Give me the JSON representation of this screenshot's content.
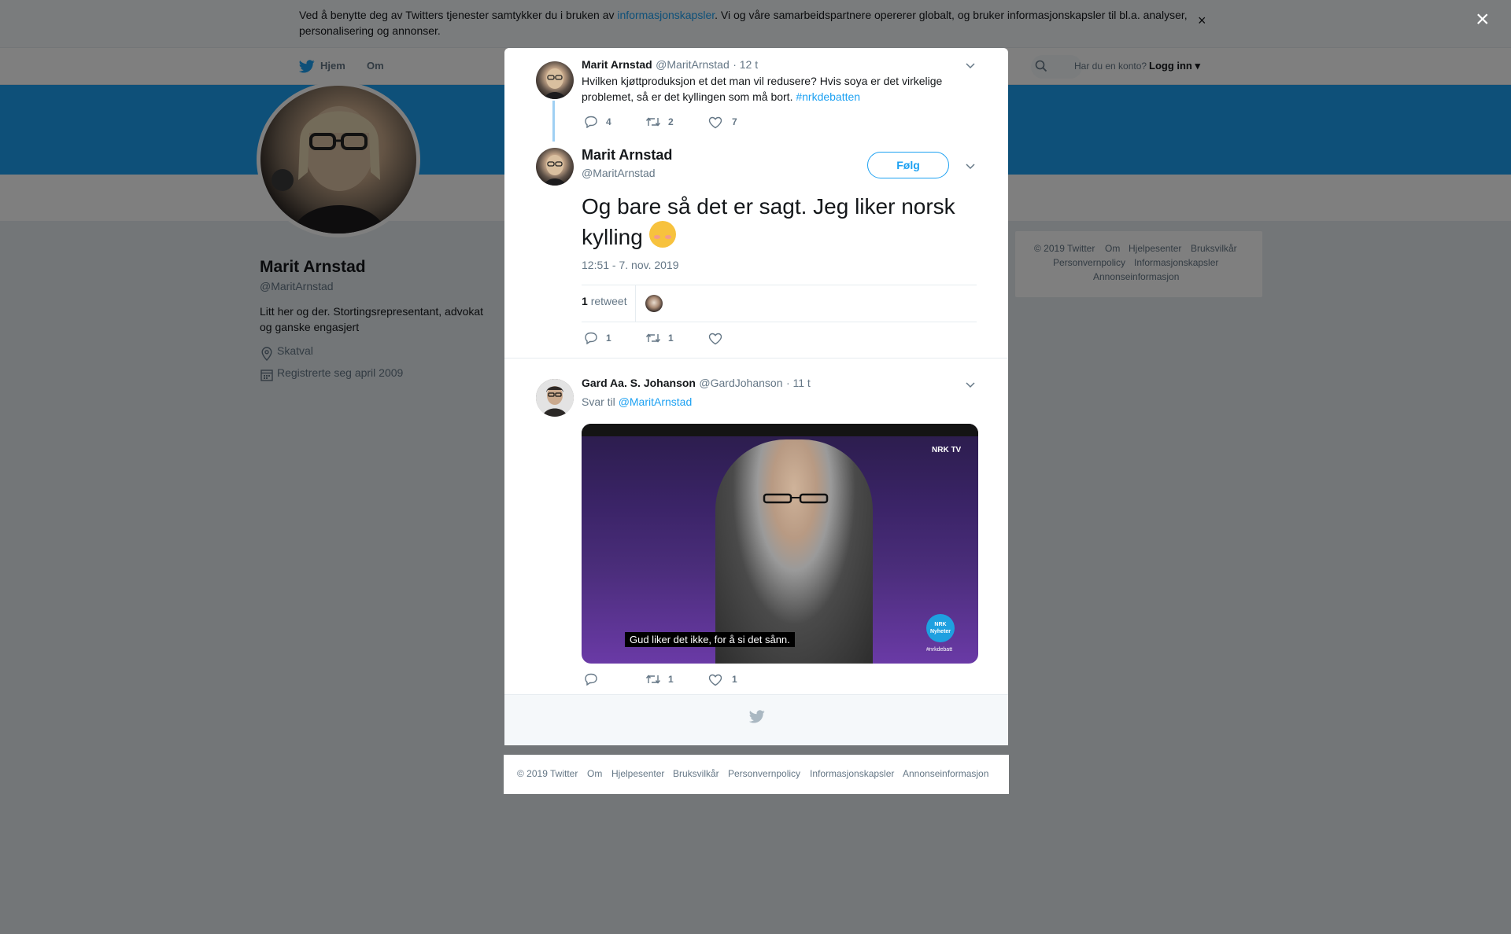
{
  "cookie_bar": {
    "text_before": "Ved å benytte deg av Twitters tjenester samtykker du i bruken av ",
    "link": "informasjonskapsler",
    "text_after": ". Vi og våre samarbeidspartnere opererer globalt, og bruker informasjonskapsler til bl.a. analyser, personalisering og annonser.",
    "close": "×"
  },
  "nav": {
    "home": "Hjem",
    "about": "Om",
    "have_account": "Har du en konto?",
    "login": "Logg inn"
  },
  "profile": {
    "name": "Marit Arnstad",
    "handle": "@MaritArnstad",
    "bio": "Litt her og der. Stortingsrepresentant, advokat og ganske engasjert",
    "location": "Skatval",
    "joined": "Registrerte seg april 2009"
  },
  "right_footer": {
    "links": [
      "© 2019 Twitter",
      "Om",
      "Hjelpesenter",
      "Bruksvilkår",
      "Personvernpolicy",
      "Informasjonskapsler",
      "Annonseinformasjon"
    ]
  },
  "overlay_close": "×",
  "tweet_parent": {
    "name": "Marit Arnstad",
    "handle": "@MaritArnstad",
    "time": "· 12 t",
    "text": "Hvilken kjøttproduksjon et det man vil redusere? Hvis soya er det virkelige problemet, så er det kyllingen som må bort. ",
    "hashtag": "#nrkdebatten",
    "replies": "4",
    "retweets": "2",
    "likes": "7"
  },
  "tweet_main": {
    "name": "Marit Arnstad",
    "handle": "@MaritArnstad",
    "follow": "Følg",
    "text": "Og bare så det er sagt. Jeg liker norsk kylling ",
    "timestamp": "12:51 - 7. nov. 2019",
    "retweet_count": "1",
    "retweet_label": "retweet",
    "replies": "1",
    "retweets": "1",
    "likes": ""
  },
  "tweet_reply": {
    "name": "Gard Aa. S. Johanson",
    "handle": "@GardJohanson",
    "time": "· 11 t",
    "reply_to_label": "Svar til",
    "reply_to": "@MaritArnstad",
    "media_caption": "Gud liker det ikke, for å si det sånn.",
    "media_logo": "NRK TV",
    "media_badge": "NRK Nyheter",
    "media_tag": "#nrkdebatt",
    "replies": "",
    "retweets": "1",
    "likes": "1"
  },
  "bottom_footer": {
    "links": [
      "© 2019 Twitter",
      "Om",
      "Hjelpesenter",
      "Bruksvilkår",
      "Personvernpolicy",
      "Informasjonskapsler",
      "Annonseinformasjon"
    ]
  },
  "icons": {
    "reply": "speech-bubble",
    "retweet": "retweet-arrows",
    "like": "heart",
    "chevron": "chevron-down",
    "bird": "twitter-bird",
    "location": "map-pin",
    "calendar": "calendar",
    "search": "magnifier"
  },
  "colors": {
    "accent": "#1da1f2",
    "text": "#14171a",
    "secondary": "#657786",
    "overlay": "rgba(0,0,0,0.5)"
  }
}
